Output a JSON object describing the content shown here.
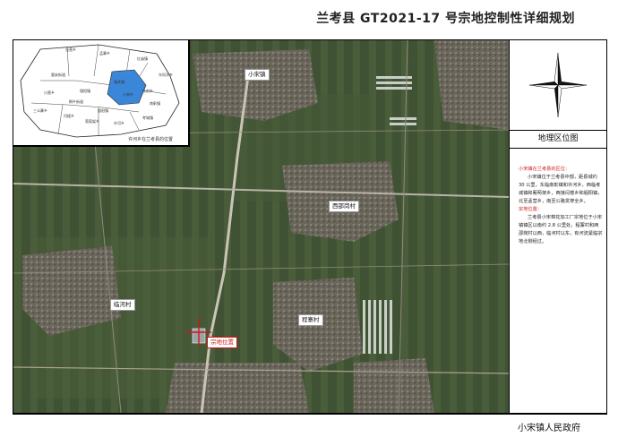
{
  "title": "兰考县 GT2021-17 号宗地控制性详细规划",
  "inset": {
    "caption": "许河乡在兰考县的位置",
    "towns": [
      "谷营乡",
      "孟寨乡",
      "红庙镇",
      "东坝头乡",
      "考城镇",
      "城关镇",
      "堌阳镇",
      "仪封乡",
      "南彰镇",
      "爪营乡",
      "三义寨乡",
      "闫楼乡",
      "葡萄架乡",
      "许河乡",
      "小宋乡",
      "固阳镇",
      "桐乡街道",
      "惠安街道"
    ],
    "highlight_color": "#3a86d8"
  },
  "labels": {
    "xiaosong": "小宋镇",
    "ximiaogang": "西邵岗村",
    "linhe": "临河村",
    "chengzhai": "程寨村",
    "site": "宗地位置"
  },
  "sidebar": {
    "panel_title": "地理区位图",
    "section1_head": "小宋镇在兰考县的区位：",
    "section1_body": "小宋镇位于兰考县中部，距县城约 30 公里，东临南彰镇和许河乡，西临考城镇和葡萄架乡，西接闫楼乡和堌阳镇，北至孟营乡，南至公路贯穿全乡。",
    "section2_head": "宗地位置：",
    "section2_body": "兰考县小宋棉花加工厂宗地位于小宋镇镇区以南约 2.8 公里处，程寨村和西邵岗村以西，临河村以东，有河流紧临宗地北侧经过。"
  },
  "footer": "小宋镇人民政府",
  "colors": {
    "accent_red": "#d01818",
    "water_blue": "#3a86d8"
  }
}
